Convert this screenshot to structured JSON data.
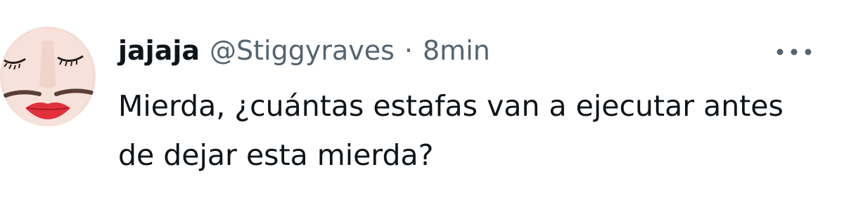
{
  "tweet": {
    "display_name": "jajaja",
    "handle": "@Stiggyraves",
    "separator": "·",
    "timestamp": "8min",
    "text": "Mierda, ¿cuántas estafas van a ejecutar antes de dejar esta mierda?",
    "more_icon": "more-horizontal-icon"
  },
  "colors": {
    "primary_text": "#0f1419",
    "secondary_text": "#536471",
    "background": "#ffffff"
  }
}
